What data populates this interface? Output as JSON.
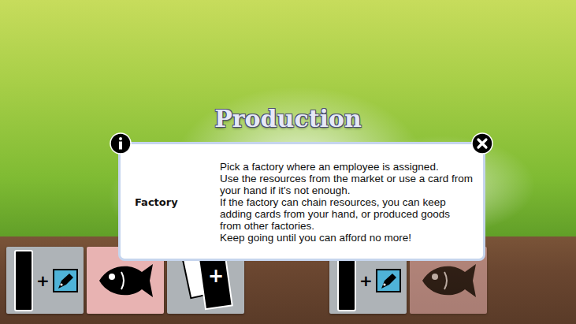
{
  "title": "Production",
  "dialog": {
    "label": "Factory",
    "lines": [
      "Pick a factory where an employee is assigned.",
      "Use the resources from the market or use a card from your hand if it's not enough.",
      "If the factory can chain resources, you can keep adding cards from your hand, or produced goods from other factories.",
      "Keep going until you can afford no more!"
    ]
  },
  "cards": [
    {
      "kind": "employee",
      "symbol": "+",
      "dimmed": false
    },
    {
      "kind": "fish",
      "dimmed": false
    },
    {
      "kind": "draw",
      "symbol": "+",
      "dimmed": false
    },
    {
      "kind": "employee",
      "symbol": "+",
      "dimmed": false
    },
    {
      "kind": "fish",
      "dimmed": true
    }
  ]
}
